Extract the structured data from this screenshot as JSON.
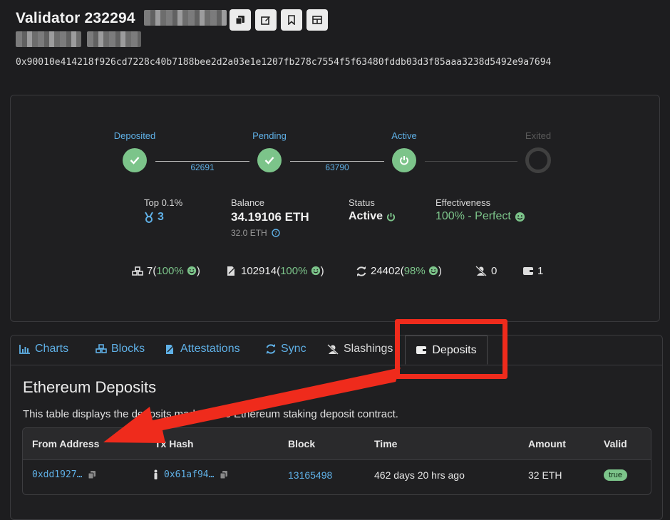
{
  "header": {
    "title": "Validator 232294",
    "pubkey": "0x90010e414218f926cd7228c40b7188bee2d2a03e1e1207fb278c7554f5f63480fddb03d3f85aaa3238d5492e9a7694",
    "buttons": [
      "copy-icon",
      "edit-icon",
      "bookmark-icon",
      "table-icon"
    ]
  },
  "lifecycle": {
    "stages": [
      {
        "label": "Deposited",
        "state": "done"
      },
      {
        "label": "Pending",
        "state": "done"
      },
      {
        "label": "Active",
        "state": "active"
      },
      {
        "label": "Exited",
        "state": "inactive"
      }
    ],
    "epochs": [
      "62691",
      "63790"
    ]
  },
  "stats": {
    "rank_label": "Top 0.1%",
    "rank_value": "3",
    "balance_label": "Balance",
    "balance_value": "34.19106 ETH",
    "balance_sub": "32.0 ETH",
    "status_label": "Status",
    "status_value": "Active",
    "effectiveness_label": "Effectiveness",
    "effectiveness_value": "100% - Perfect"
  },
  "metrics": {
    "proposals": "7",
    "proposals_pct": "100%",
    "attestations": "102914",
    "attestations_pct": "100%",
    "sync": "24402",
    "sync_pct": "98%",
    "slashings": "0",
    "deposits": "1"
  },
  "tabs": [
    {
      "label": "Charts",
      "icon": "chart-icon"
    },
    {
      "label": "Blocks",
      "icon": "cubes-icon"
    },
    {
      "label": "Attestations",
      "icon": "file-signature-icon"
    },
    {
      "label": "Sync",
      "icon": "sync-icon"
    },
    {
      "label": "Slashings",
      "icon": "user-slash-icon"
    },
    {
      "label": "Deposits",
      "icon": "wallet-icon",
      "active": true
    }
  ],
  "deposits_section": {
    "title": "Ethereum Deposits",
    "description": "This table displays the deposits made to the Ethereum staking deposit contract.",
    "columns": [
      "From Address",
      "Tx Hash",
      "Block",
      "Time",
      "Amount",
      "Valid"
    ],
    "rows": [
      {
        "from": "0xdd1927…",
        "tx": "0x61af94…",
        "block": "13165498",
        "time": "462 days 20 hrs ago",
        "amount": "32 ETH",
        "valid": "true"
      }
    ]
  },
  "annotation": {
    "color": "#ef2b1c"
  }
}
